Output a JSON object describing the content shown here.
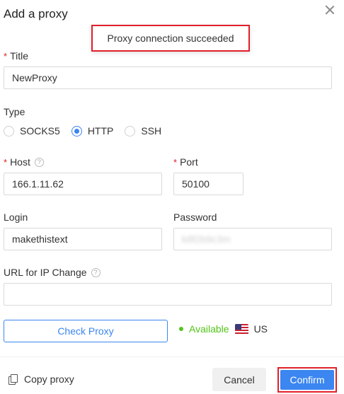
{
  "dialog": {
    "title": "Add a proxy"
  },
  "toast": {
    "message": "Proxy connection succeeded"
  },
  "fields": {
    "title": {
      "label": "Title",
      "required": "*",
      "value": "NewProxy"
    },
    "type": {
      "label": "Type",
      "options": [
        "SOCKS5",
        "HTTP",
        "SSH"
      ],
      "selected": "HTTP"
    },
    "host": {
      "label": "Host",
      "required": "*",
      "value": "166.1.11.62"
    },
    "port": {
      "label": "Port",
      "required": "*",
      "value": "50100"
    },
    "login": {
      "label": "Login",
      "value": "makethistext"
    },
    "password": {
      "label": "Password",
      "value": "k8f2b9c3m"
    },
    "url_ip_change": {
      "label": "URL for IP Change",
      "value": ""
    }
  },
  "check": {
    "button_label": "Check Proxy",
    "status": "Available",
    "country": "US",
    "status_color": "#52c41a"
  },
  "footer": {
    "copy_label": "Copy proxy",
    "cancel_label": "Cancel",
    "confirm_label": "Confirm"
  },
  "colors": {
    "accent": "#3b86f0",
    "highlight": "#e0202a",
    "required": "#e0202a"
  }
}
